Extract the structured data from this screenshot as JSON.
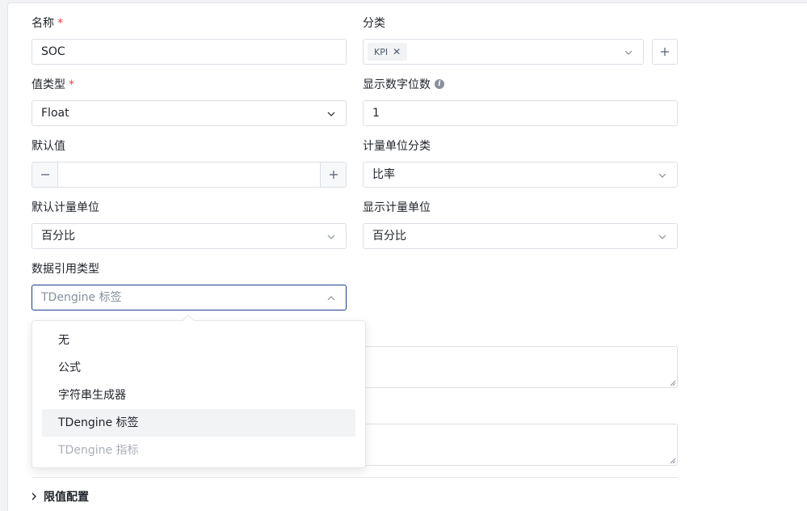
{
  "form": {
    "name": {
      "label": "名称",
      "required_mark": "*",
      "value": "SOC"
    },
    "category": {
      "label": "分类",
      "tags": [
        "KPI"
      ]
    },
    "value_type": {
      "label": "值类型",
      "required_mark": "*",
      "value": "Float"
    },
    "display_digits": {
      "label": "显示数字位数",
      "value": "1"
    },
    "default_value": {
      "label": "默认值",
      "value": "",
      "minus": "−",
      "plus": "+"
    },
    "unit_category": {
      "label": "计量单位分类",
      "value": "比率"
    },
    "default_unit": {
      "label": "默认计量单位",
      "value": "百分比"
    },
    "display_unit": {
      "label": "显示计量单位",
      "value": "百分比"
    },
    "data_ref_type": {
      "label": "数据引用类型",
      "placeholder": "TDengine 标签"
    }
  },
  "dropdown": {
    "options": [
      {
        "label": "无",
        "state": "normal"
      },
      {
        "label": "公式",
        "state": "normal"
      },
      {
        "label": "字符串生成器",
        "state": "normal"
      },
      {
        "label": "TDengine 标签",
        "state": "active"
      },
      {
        "label": "TDengine 指标",
        "state": "disabled"
      }
    ]
  },
  "section": {
    "label": "限值配置"
  },
  "colors": {
    "accent": "#1d3f8f",
    "required": "#f53f3f",
    "border": "#dcdfe6",
    "option_hover": "#f2f3f5"
  }
}
